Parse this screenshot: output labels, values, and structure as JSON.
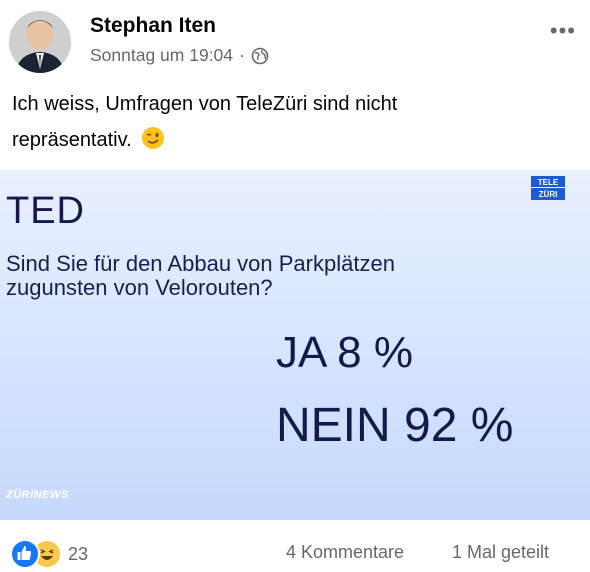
{
  "post": {
    "author": "Stephan Iten",
    "timestamp": "Sonntag um 19:04",
    "separator": "·",
    "audience_icon": "globe-icon",
    "more_icon": "more-options-icon",
    "text_line1": "Ich weiss, Umfragen von TeleZüri sind nicht",
    "text_line2": "repräsentativ.",
    "emoji": "winking-face-emoji"
  },
  "media": {
    "heading": "TED",
    "question_line1": "Sind Sie für den Abbau von Parkplätzen",
    "question_line2": "zugunsten von Velorouten?",
    "yes_result": "JA 8 %",
    "no_result": "NEIN 92 %",
    "brand": "ZÜRINEWS",
    "logo_line1": "TELE",
    "logo_line2": "ZÜRI"
  },
  "footer": {
    "reaction_icons": [
      "like-icon",
      "haha-icon"
    ],
    "reaction_count": "23",
    "comments": "4 Kommentare",
    "shares": "1 Mal geteilt"
  },
  "colors": {
    "brand_blue": "#1877f2",
    "text_dark": "#050505",
    "text_muted": "#65676b",
    "tv_text": "#14194a"
  }
}
